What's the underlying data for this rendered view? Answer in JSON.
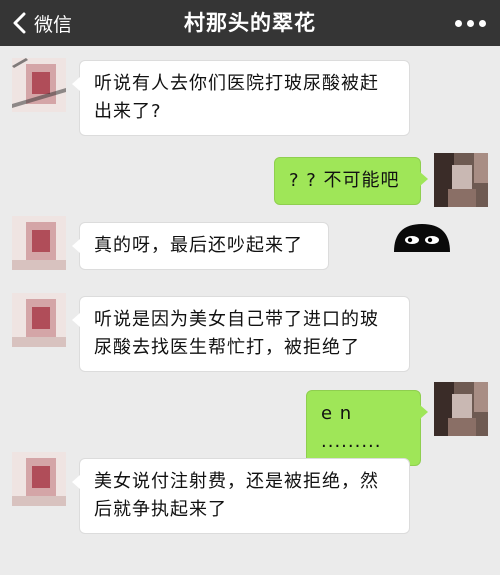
{
  "header": {
    "back_label": "微信",
    "title": "村那头的翠花"
  },
  "messages": [
    {
      "side": "left",
      "text": "听说有人去你们医院打玻尿酸被赶出来了?"
    },
    {
      "side": "right",
      "text": "? ? 不可能吧"
    },
    {
      "side": "left",
      "text": "真的呀，最后还吵起来了"
    },
    {
      "side": "left",
      "text": "听说是因为美女自己带了进口的玻尿酸去找医生帮忙打，被拒绝了"
    },
    {
      "side": "right",
      "text": "e n ........."
    },
    {
      "side": "left",
      "text": "美女说付注射费，还是被拒绝，然后就争执起来了"
    }
  ],
  "icons": {
    "back": "chevron-left-icon",
    "more": "more-dots-icon",
    "sticker": "peeking-face-sticker"
  },
  "colors": {
    "header_bg": "#353535",
    "chat_bg": "#ebebeb",
    "sent_bubble": "#9fe658",
    "received_bubble": "#ffffff"
  }
}
